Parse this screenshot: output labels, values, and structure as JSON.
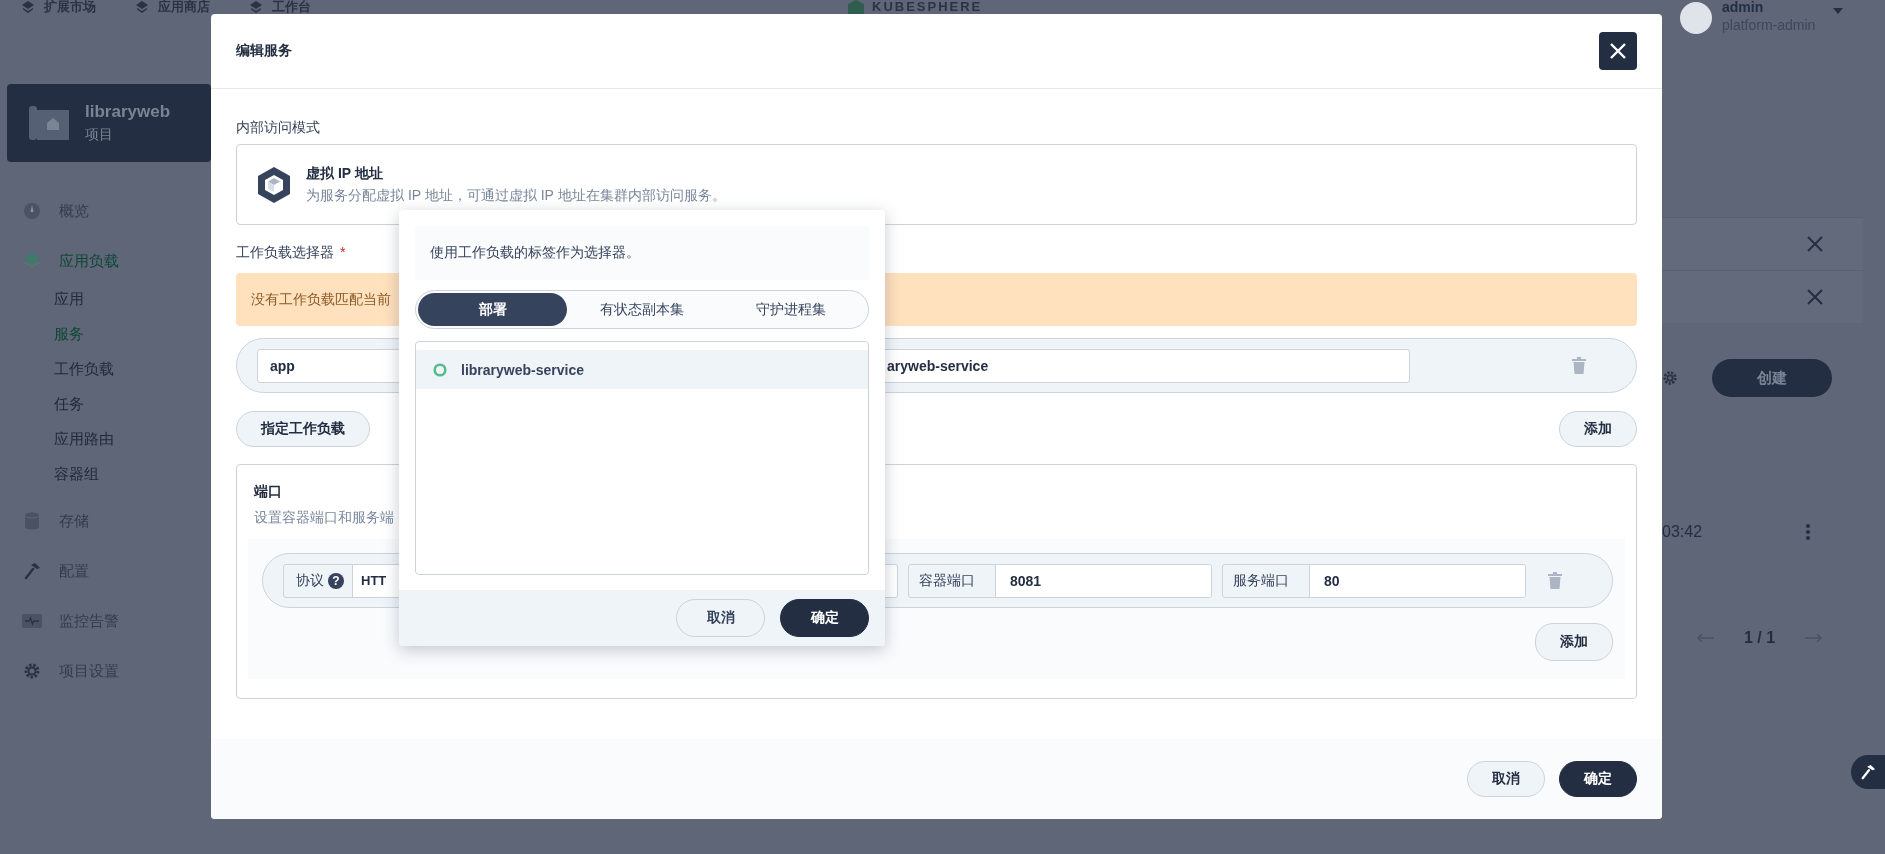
{
  "top_bar": {
    "items": [
      {
        "label": "扩展市场"
      },
      {
        "label": "应用商店"
      },
      {
        "label": "工作台"
      }
    ],
    "logo": "KUBESPHERE",
    "user": {
      "name": "admin",
      "role": "platform-admin"
    }
  },
  "sidebar": {
    "project": {
      "name": "libraryweb",
      "type": "项目"
    },
    "items": [
      {
        "label": "概览",
        "selected": false
      },
      {
        "label": "应用负载",
        "selected": true,
        "children": [
          {
            "label": "应用",
            "selected": false
          },
          {
            "label": "服务",
            "selected": true
          },
          {
            "label": "工作负载",
            "selected": false
          },
          {
            "label": "任务",
            "selected": false
          },
          {
            "label": "应用路由",
            "selected": false
          },
          {
            "label": "容器组",
            "selected": false
          }
        ]
      },
      {
        "label": "存储",
        "selected": false
      },
      {
        "label": "配置",
        "selected": false
      },
      {
        "label": "监控告警",
        "selected": false
      },
      {
        "label": "项目设置",
        "selected": false
      }
    ]
  },
  "background": {
    "create_button": "创建",
    "time": "03:42",
    "pagination": "1 / 1"
  },
  "modal": {
    "title": "编辑服务",
    "access_mode": {
      "label": "内部访问模式",
      "option_title": "虚拟 IP 地址",
      "option_description": "为服务分配虚拟 IP 地址，可通过虚拟 IP 地址在集群内部访问服务。"
    },
    "selector": {
      "label": "工作负载选择器",
      "required_mark": "*",
      "alert": "没有工作负载匹配当前",
      "labels": [
        {
          "key": "app",
          "value": "aryweb-service"
        }
      ],
      "specify_button": "指定工作负载",
      "add_button": "添加"
    },
    "ports": {
      "title": "端口",
      "description": "设置容器端口和服务端",
      "rows": [
        {
          "protocol_label": "协议",
          "help": "?",
          "protocol": "HTT",
          "container_port_label": "容器端口",
          "container_port": "8081",
          "service_port_label": "服务端口",
          "service_port": "80"
        }
      ],
      "add_button": "添加"
    },
    "buttons": {
      "cancel": "取消",
      "ok": "确定"
    }
  },
  "popover": {
    "hint": "使用工作负载的标签作为选择器。",
    "tabs": [
      {
        "label": "部署",
        "selected": true
      },
      {
        "label": "有状态副本集",
        "selected": false
      },
      {
        "label": "守护进程集",
        "selected": false
      }
    ],
    "items": [
      {
        "name": "libraryweb-service",
        "selected": true
      }
    ],
    "buttons": {
      "cancel": "取消",
      "ok": "确定"
    }
  }
}
